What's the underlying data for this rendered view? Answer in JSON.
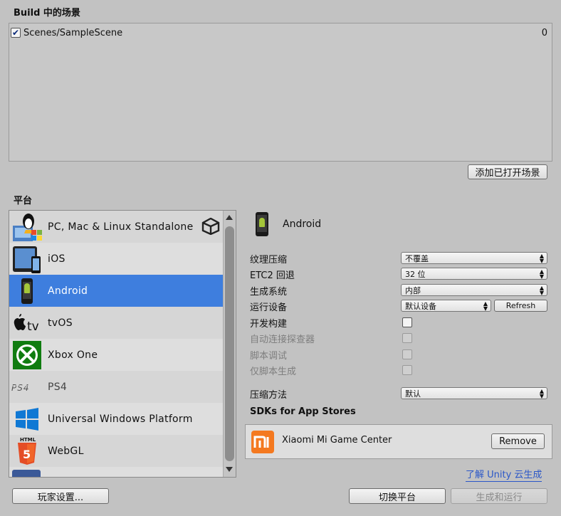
{
  "scenes_section": {
    "title": "Build 中的场景",
    "scenes": [
      {
        "checked": true,
        "path": "Scenes/SampleScene",
        "index": "0"
      }
    ],
    "add_open_scenes_label": "添加已打开场景"
  },
  "platform_section": {
    "title": "平台",
    "platforms": [
      {
        "name": "PC, Mac & Linux Standalone",
        "icon": "pc-mac-linux-icon"
      },
      {
        "name": "iOS",
        "icon": "ios-icon"
      },
      {
        "name": "Android",
        "icon": "android-icon",
        "selected": true
      },
      {
        "name": "tvOS",
        "icon": "tvos-icon"
      },
      {
        "name": "Xbox One",
        "icon": "xbox-icon"
      },
      {
        "name": "PS4",
        "icon": "ps4-icon"
      },
      {
        "name": "Universal Windows Platform",
        "icon": "windows-icon"
      },
      {
        "name": "WebGL",
        "icon": "html5-icon"
      }
    ]
  },
  "settings": {
    "platform_title": "Android",
    "texture_compression": {
      "label": "纹理压缩",
      "value": "不覆盖"
    },
    "etc2_fallback": {
      "label": "ETC2 回退",
      "value": "32 位"
    },
    "build_system": {
      "label": "生成系统",
      "value": "内部"
    },
    "run_device": {
      "label": "运行设备",
      "value": "默认设备",
      "refresh_label": "Refresh"
    },
    "development_build": {
      "label": "开发构建",
      "checked": false
    },
    "autoconnect_profiler": {
      "label": "自动连接探查器",
      "checked": false
    },
    "script_debugging": {
      "label": "脚本调试",
      "checked": false
    },
    "scripts_only_build": {
      "label": "仅脚本生成",
      "checked": false
    },
    "compression_method": {
      "label": "压缩方法",
      "value": "默认"
    }
  },
  "sdks": {
    "title": "SDKs for App Stores",
    "items": [
      {
        "name": "Xiaomi Mi Game Center",
        "icon": "xiaomi-logo-icon",
        "remove_label": "Remove"
      }
    ]
  },
  "footer": {
    "cloud_link": "了解 Unity 云生成",
    "player_settings_label": "玩家设置...",
    "switch_platform_label": "切换平台",
    "build_and_run_label": "生成和运行"
  },
  "colors": {
    "background": "#c2c2c2",
    "selection": "#3e7ede",
    "link": "#2b57c8",
    "xiaomi_orange": "#f47920",
    "xbox_green": "#107c10",
    "windows_blue": "#0f78d4",
    "html5_orange": "#e44d26"
  }
}
